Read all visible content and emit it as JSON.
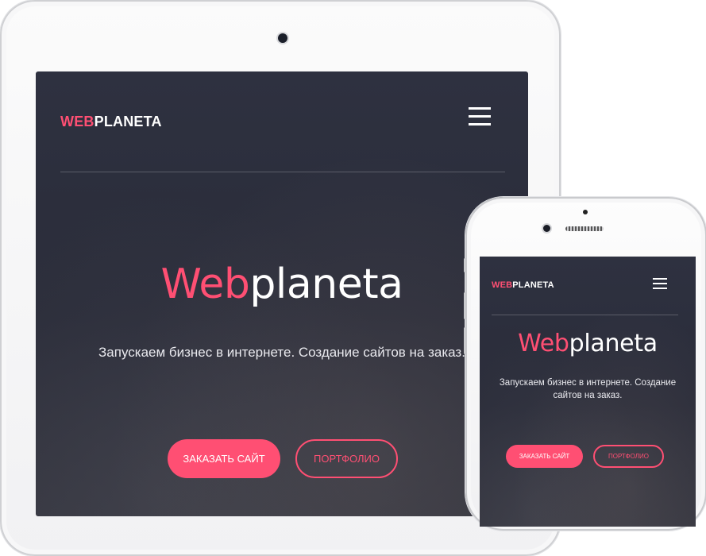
{
  "brand": {
    "logo_accent": "WEB",
    "logo_rest": "PLANETA",
    "accent_color": "#ff4f73"
  },
  "hero": {
    "title_accent": "Web",
    "title_rest": "planeta",
    "subtitle": "Запускаем бизнес в интернете. Создание сайтов на заказ."
  },
  "buttons": {
    "order_label": "ЗАКАЗАТЬ САЙТ",
    "portfolio_label": "ПОРТФОЛИО"
  },
  "icons": {
    "menu": "hamburger-menu-icon"
  }
}
